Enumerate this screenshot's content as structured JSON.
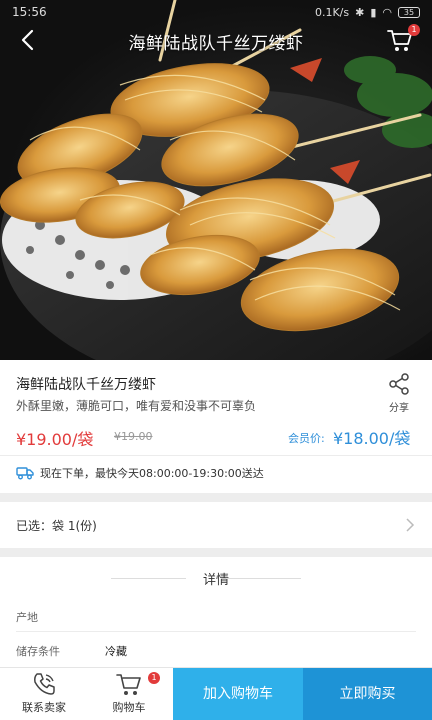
{
  "status_bar": {
    "time": "15:56",
    "network": "0.1K/s",
    "battery": "35"
  },
  "nav": {
    "title": "海鲜陆战队千丝万缕虾",
    "cart_badge": "1"
  },
  "product": {
    "name": "海鲜陆战队千丝万缕虾",
    "description": "外酥里嫩，薄脆可口，唯有爱和没事不可辜负",
    "share_label": "分享",
    "price": "¥19.00/袋",
    "original_price": "¥19.00",
    "member_label": "会员价:",
    "member_price": "¥18.00/袋",
    "delivery": "现在下单，最快今天08:00:00-19:30:00送达"
  },
  "spec": {
    "selected": "已选：袋   1(份)"
  },
  "details": {
    "title": "详情",
    "rows": [
      {
        "key": "产地",
        "value": ""
      },
      {
        "key": "储存条件",
        "value": "冷藏"
      }
    ]
  },
  "bottom_bar": {
    "contact_label": "联系卖家",
    "cart_label": "购物车",
    "cart_badge": "1",
    "add_to_cart": "加入购物车",
    "buy_now": "立即购买"
  },
  "colors": {
    "price_red": "#e23b3b",
    "member_blue": "#2f8fd9",
    "cart_button": "#2fb0ea",
    "buy_button": "#1e93d6"
  }
}
